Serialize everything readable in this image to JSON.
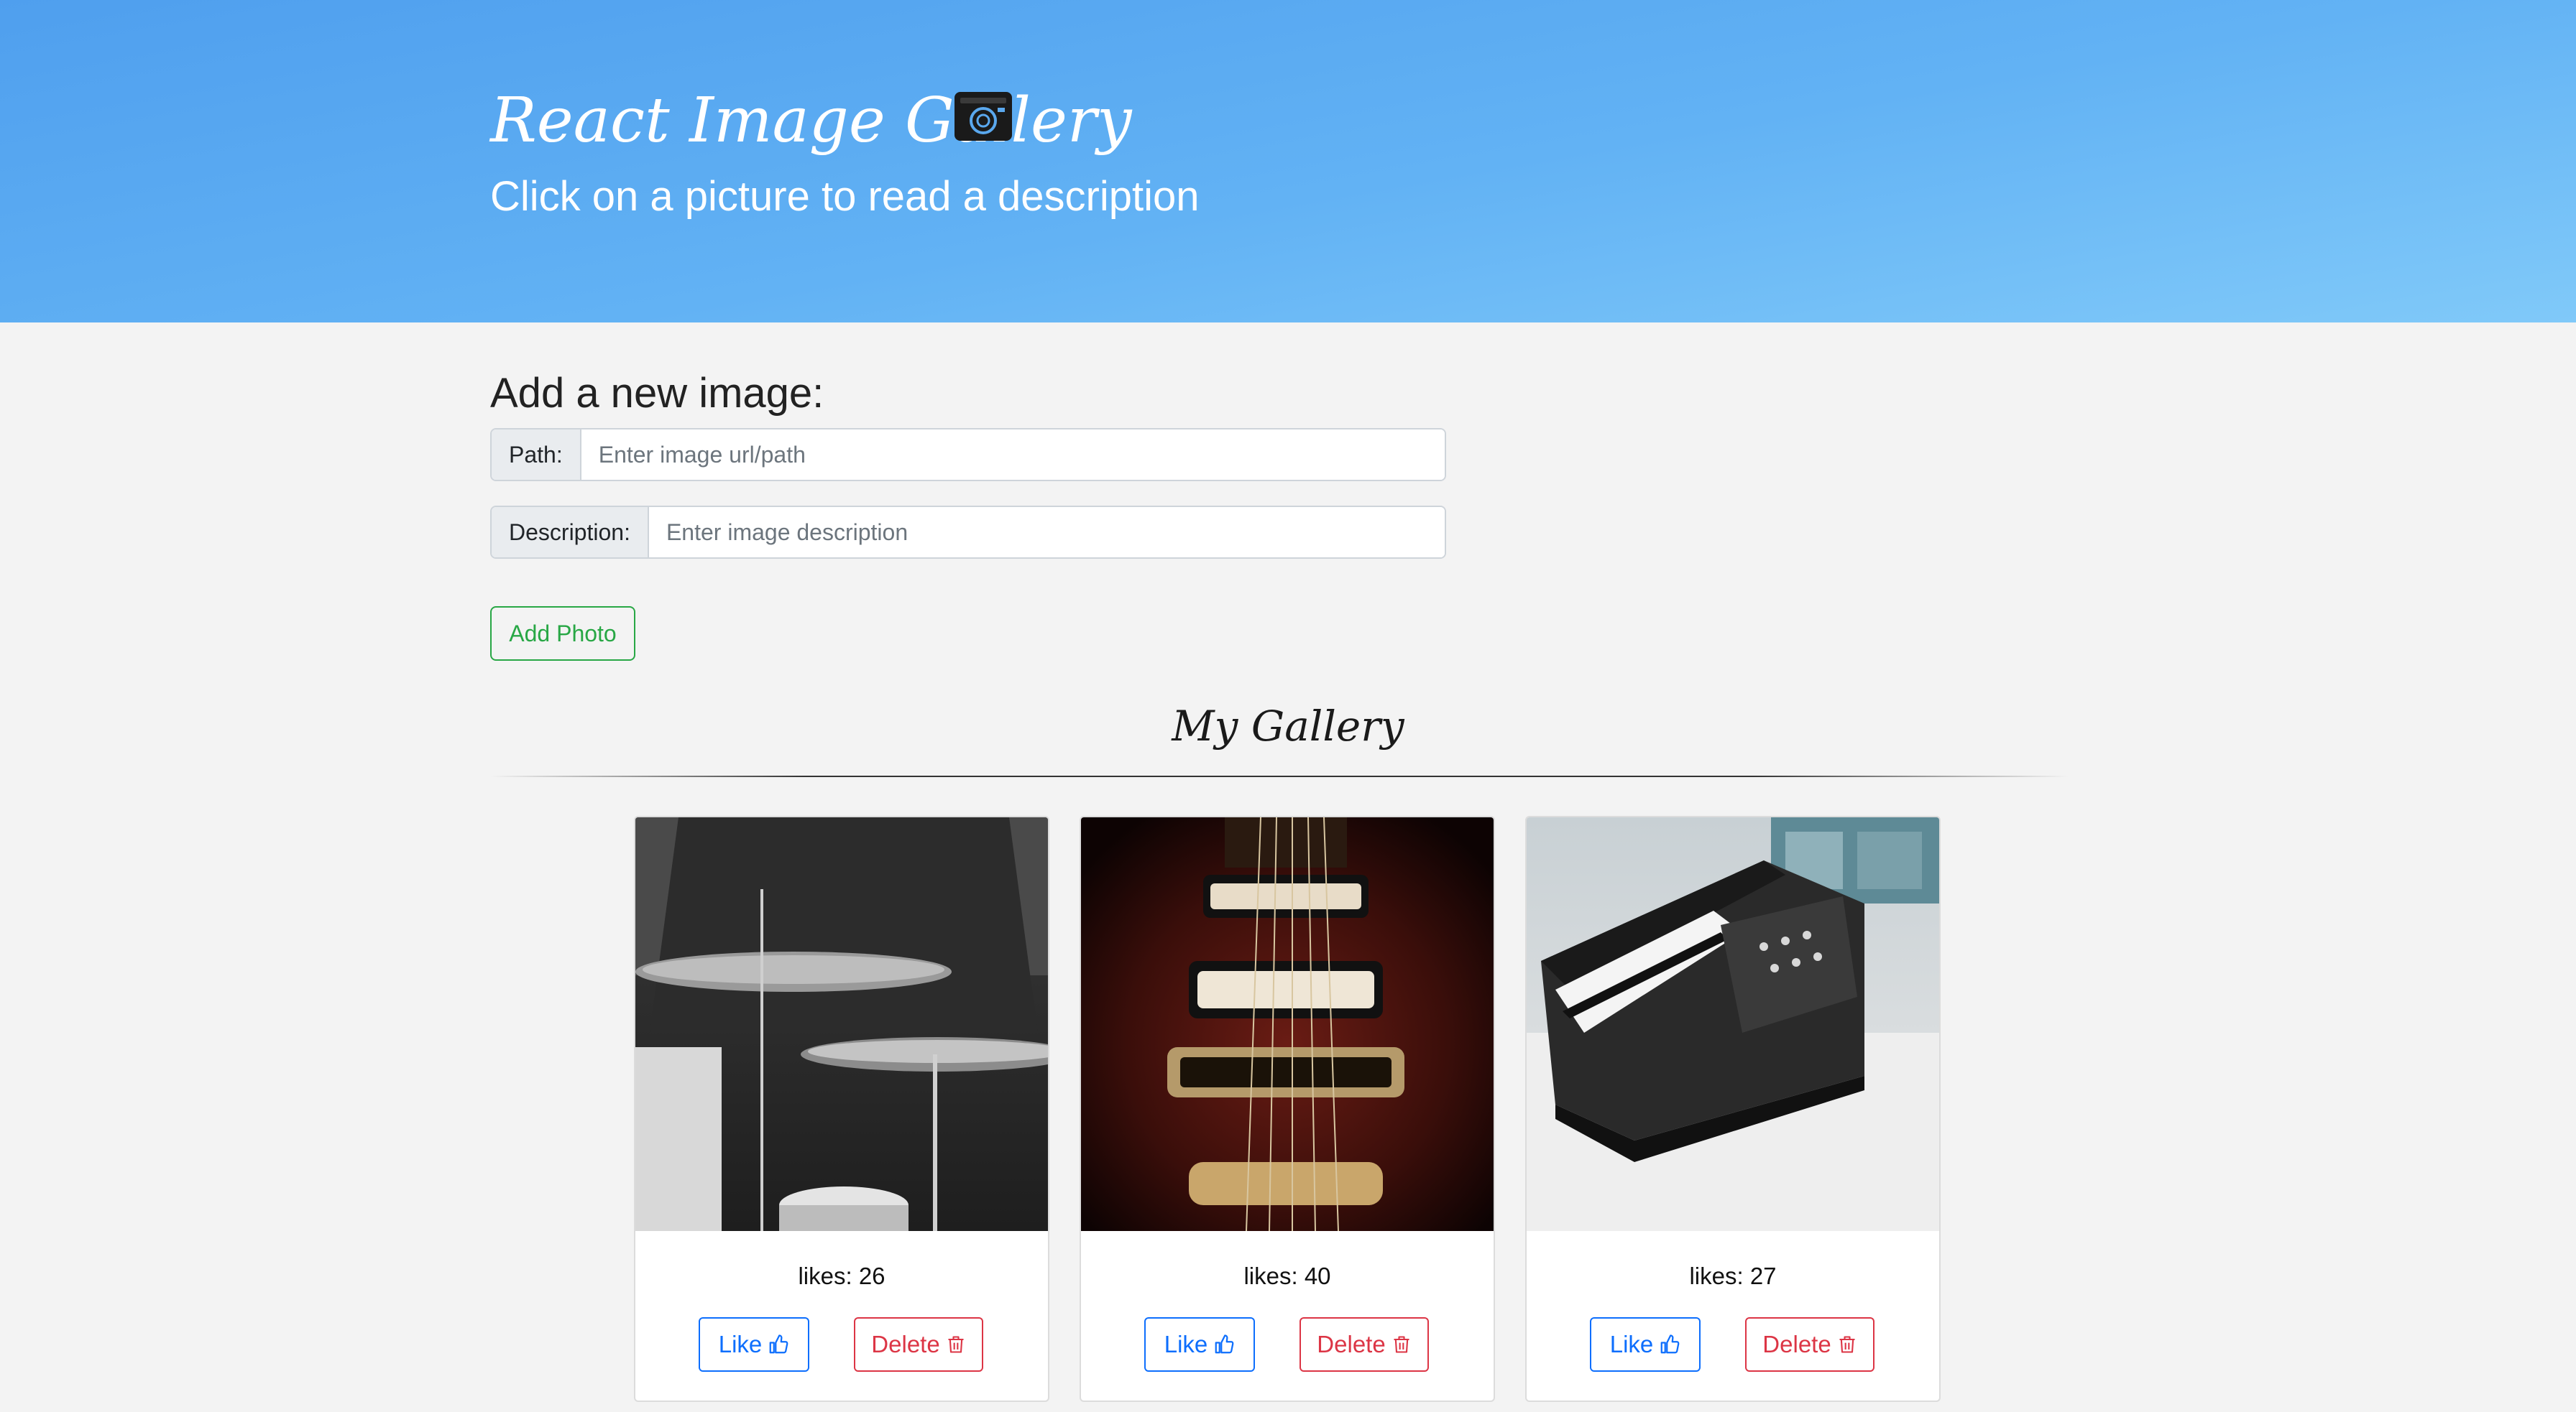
{
  "header": {
    "title": "React Image Gallery",
    "subtitle": "Click on a picture to read a description",
    "icon": "camera-icon"
  },
  "form": {
    "heading": "Add a new image:",
    "path_label": "Path:",
    "path_placeholder": "Enter image url/path",
    "description_label": "Description:",
    "description_placeholder": "Enter image description",
    "add_button": "Add Photo"
  },
  "gallery": {
    "title": "My Gallery",
    "cards": [
      {
        "image": "drummer-photo",
        "likes": "likes: 26",
        "like_label": "Like",
        "delete_label": "Delete"
      },
      {
        "image": "electric-guitar-photo",
        "likes": "likes: 40",
        "like_label": "Like",
        "delete_label": "Delete"
      },
      {
        "image": "synthesizer-photo",
        "likes": "likes: 27",
        "like_label": "Like",
        "delete_label": "Delete"
      }
    ]
  },
  "colors": {
    "header_gradient_start": "#4f9fee",
    "header_gradient_end": "#80c9f9",
    "success": "#28a745",
    "primary": "#0d6efd",
    "danger": "#dc3545",
    "page_background": "#f3f3f3"
  }
}
